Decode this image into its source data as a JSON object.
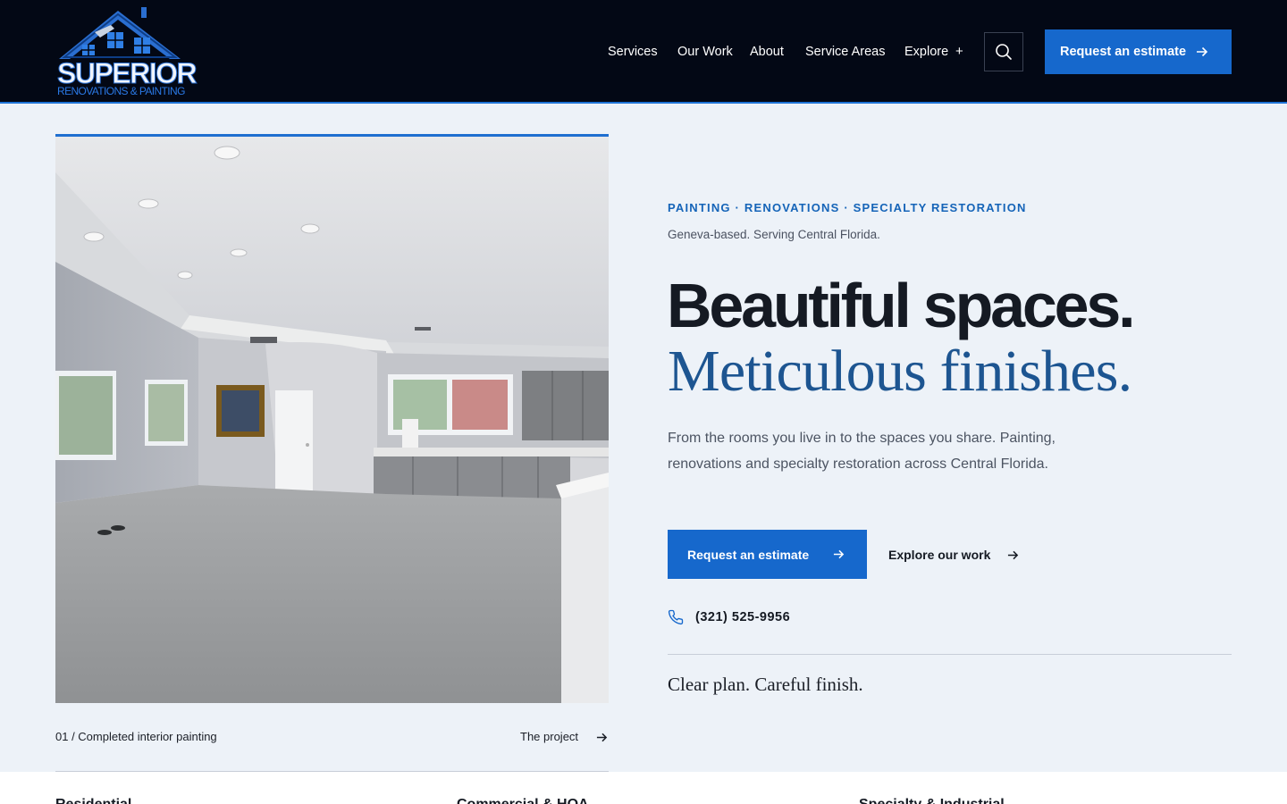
{
  "brand": {
    "name": "SUPERIOR",
    "subtitle": "RENOVATIONS & PAINTING"
  },
  "nav": {
    "items": [
      "Services",
      "Our Work",
      "About",
      "Service Areas",
      "Explore"
    ],
    "explore_toggle": "+",
    "cta_label": "Request an estimate"
  },
  "hero": {
    "eyebrow": "PAINTING · RENOVATIONS · SPECIALTY RESTORATION",
    "location": "Geneva-based. Serving Central Florida.",
    "headline_line1": "Beautiful spaces.",
    "headline_line2": "Meticulous finishes.",
    "description": "From the rooms you live in to the spaces you share. Painting, renovations and specialty restoration across Central Florida.",
    "primary_cta": "Request an estimate",
    "secondary_cta": "Explore our work",
    "phone": "(321) 525-9956",
    "tagline": "Clear plan. Careful finish."
  },
  "gallery": {
    "caption": "01 / Completed interior painting",
    "link_label": "The project"
  },
  "categories": [
    "Residential",
    "Commercial & HOA",
    "Specialty & Industrial"
  ],
  "icons": {
    "search": "search-icon",
    "arrow": "arrow-right-icon",
    "phone": "phone-icon"
  },
  "colors": {
    "header_bg": "#030815",
    "accent": "#1668cc",
    "page_bg": "#edf2f8",
    "serif_headline": "#1d5591",
    "eyebrow": "#1564b8"
  }
}
